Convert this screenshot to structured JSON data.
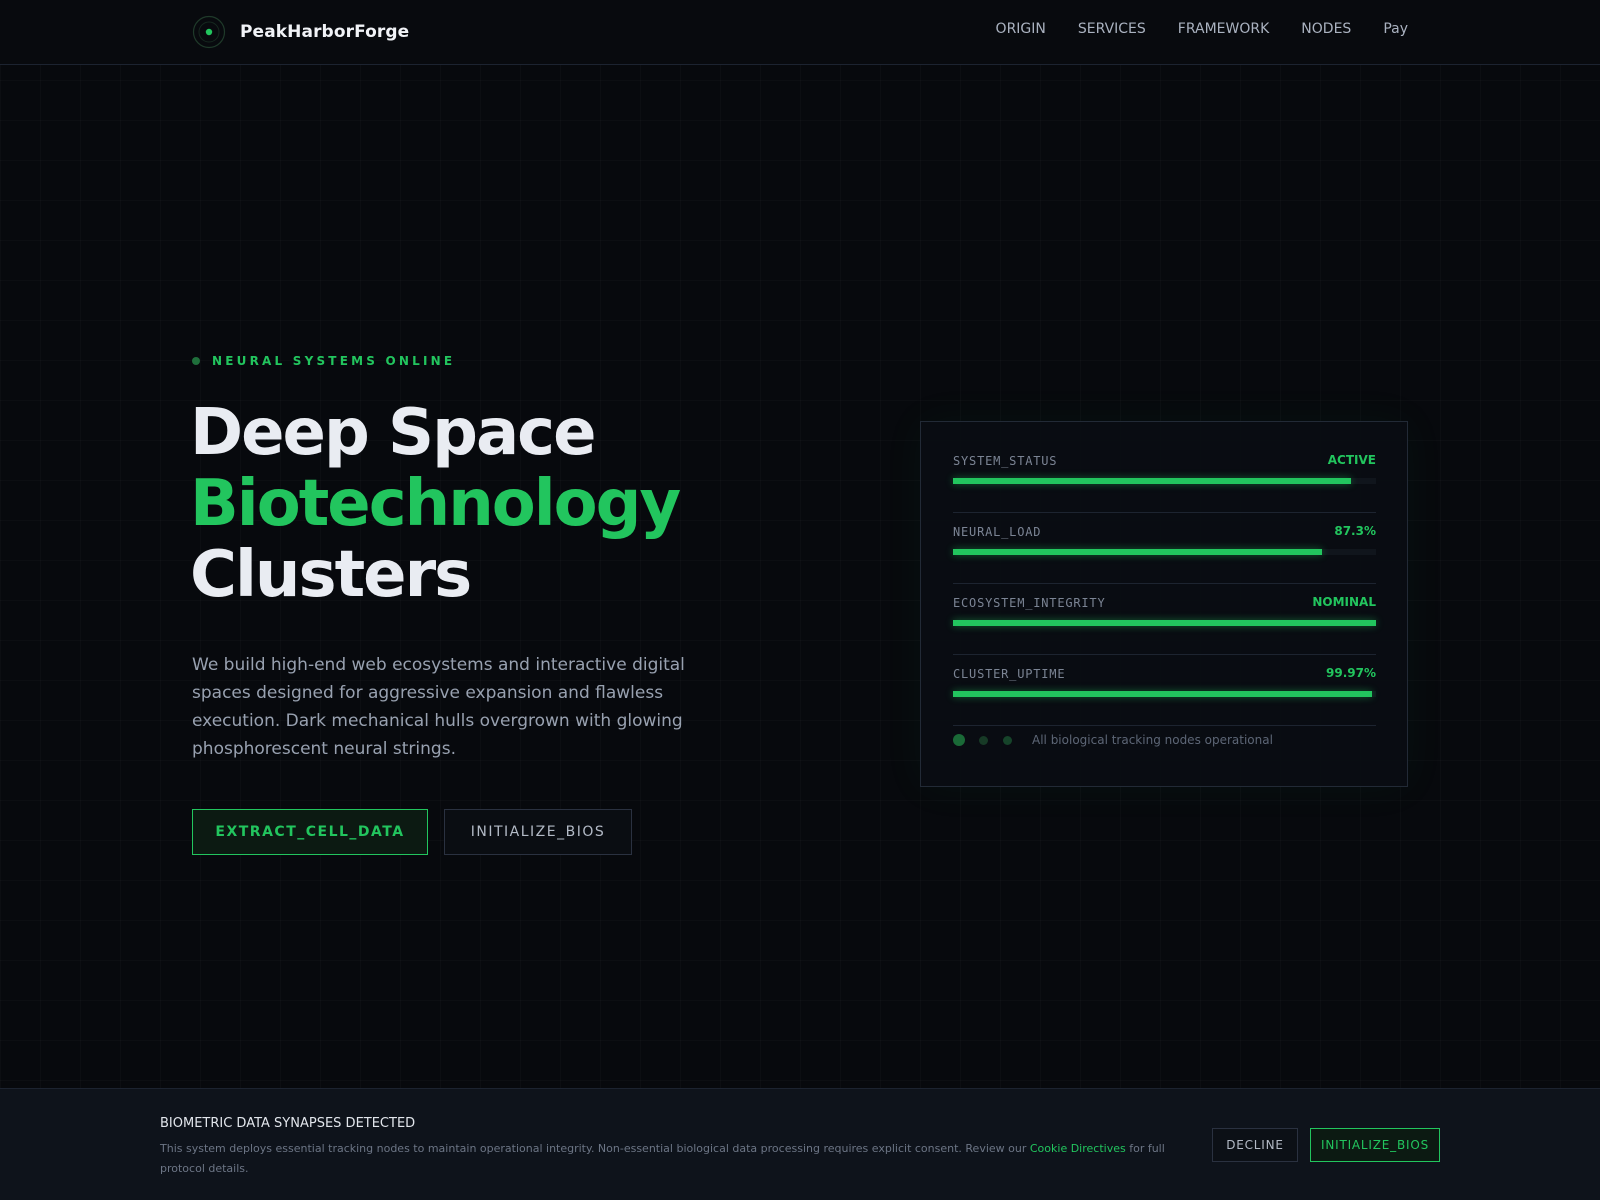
{
  "brand": {
    "name": "PeakHarborForge",
    "logo_icon": "target-radar-icon"
  },
  "nav": {
    "items": [
      {
        "label": "ORIGIN"
      },
      {
        "label": "SERVICES"
      },
      {
        "label": "FRAMEWORK"
      },
      {
        "label": "NODES"
      },
      {
        "label": "Pay"
      }
    ]
  },
  "hero": {
    "status_text": "NEURAL SYSTEMS ONLINE",
    "title_line1": "Deep Space",
    "title_line2": "Biotechnology",
    "title_line3": "Clusters",
    "description": "We build high-end web ecosystems and interactive digital spaces designed for aggressive expansion and flawless execution. Dark mechanical hulls overgrown with glowing phosphorescent neural strings.",
    "primary_button": "EXTRACT_CELL_DATA",
    "secondary_button": "INITIALIZE_BIOS"
  },
  "panel": {
    "metrics": [
      {
        "label": "SYSTEM_STATUS",
        "value": "ACTIVE",
        "fill_percent": 94
      },
      {
        "label": "NEURAL_LOAD",
        "value": "87.3%",
        "fill_percent": 87.3
      },
      {
        "label": "ECOSYSTEM_INTEGRITY",
        "value": "NOMINAL",
        "fill_percent": 100
      },
      {
        "label": "CLUSTER_UPTIME",
        "value": "99.97%",
        "fill_percent": 99
      }
    ],
    "footer_text": "All biological tracking nodes operational"
  },
  "cookie": {
    "title": "BIOMETRIC DATA SYNAPSES DETECTED",
    "text_before": "This system deploys essential tracking nodes to maintain operational integrity. Non-essential biological data processing requires explicit consent. Review our",
    "link_text": "Cookie Directives",
    "text_after": "for full protocol details.",
    "decline_label": "DECLINE",
    "accept_label": "INITIALIZE_BIOS"
  },
  "colors": {
    "accent": "#22c55e",
    "background": "#07090d",
    "text_primary": "#e9ecf2",
    "text_muted": "#98a1b0"
  }
}
